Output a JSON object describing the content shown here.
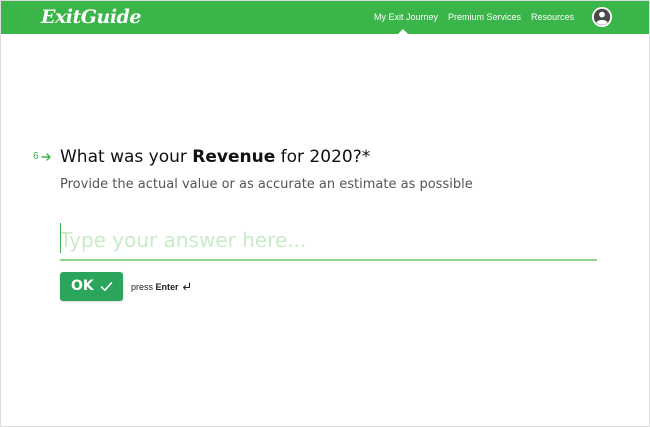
{
  "header": {
    "logo_text": "ExitGuide",
    "nav": [
      {
        "label": "My Exit Journey"
      },
      {
        "label": "Premium Services"
      },
      {
        "label": "Resources"
      }
    ],
    "active_nav": "My Exit Journey",
    "avatar_icon": "user-avatar-icon"
  },
  "question": {
    "number": "6",
    "arrow_icon": "arrow-right-icon",
    "text_before": "What was your ",
    "text_bold": "Revenue",
    "text_after": " for 2020?*",
    "subtitle": "Provide the actual value or as accurate an estimate as possible"
  },
  "answer": {
    "value": "",
    "placeholder": "Type your answer here..."
  },
  "submit": {
    "label": "OK",
    "check_icon": "check-icon"
  },
  "hint": {
    "prefix": "press ",
    "key": "Enter",
    "icon": "enter-return-icon"
  },
  "colors": {
    "brand_green": "#3ab54a",
    "button_green": "#2aa55b",
    "placeholder_green": "#c8ebc8"
  }
}
